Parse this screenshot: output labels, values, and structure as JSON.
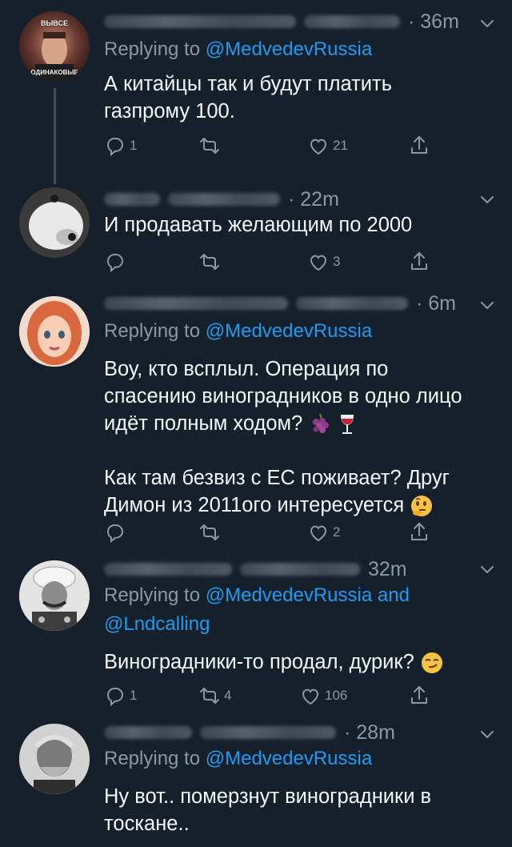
{
  "tweets": [
    {
      "time": "· 36m",
      "replying_prefix": "Replying to ",
      "replying_to": "@MedvedevRussia",
      "replying_and": "",
      "replying_to2": "",
      "text": "А китайцы так и будут платить газпрому 100.",
      "counts": {
        "reply": "1",
        "retweet": "",
        "like": "21"
      },
      "avatar_text_top": "ВЫВСЕ",
      "avatar_text_bottom": "ОДИНАКОВЫЕ"
    },
    {
      "time": "· 22m",
      "text": "И продавать желающим по 2000",
      "counts": {
        "reply": "",
        "retweet": "",
        "like": "3"
      }
    },
    {
      "time": "· 6m",
      "replying_prefix": "Replying to ",
      "replying_to": "@MedvedevRussia",
      "text_line1": "Воу, кто всплыл. Операция по",
      "text_line2": "спасению виноградников в одно лицо",
      "text_line3": "идёт полным ходом?",
      "text_line4": "Как там безвиз с ЕС поживает? Друг",
      "text_line5": "Димон из 2011ого интересуется",
      "counts": {
        "reply": "",
        "retweet": "",
        "like": "2"
      }
    },
    {
      "time": "32m",
      "replying_prefix": "Replying to ",
      "replying_to": "@MedvedevRussia",
      "replying_and": " and",
      "replying_to2": "@Lndcalling",
      "text": "Виноградники-то продал, дурик?",
      "counts": {
        "reply": "1",
        "retweet": "4",
        "like": "106"
      }
    },
    {
      "time": "· 28m",
      "replying_prefix": "Replying to ",
      "replying_to": "@MedvedevRussia",
      "text_line1": "Ну вот.. померзнут виноградники в",
      "text_line2": "тоскане.."
    }
  ],
  "colors": {
    "background": "#15202b",
    "mention": "#1d9bf0",
    "muted": "#8899a6"
  },
  "icons": [
    "reply-icon",
    "retweet-icon",
    "like-icon",
    "share-icon",
    "chevron-down-icon",
    "grapes-emoji",
    "wine-glass-emoji",
    "thinking-face-emoji",
    "smirking-face-emoji"
  ]
}
